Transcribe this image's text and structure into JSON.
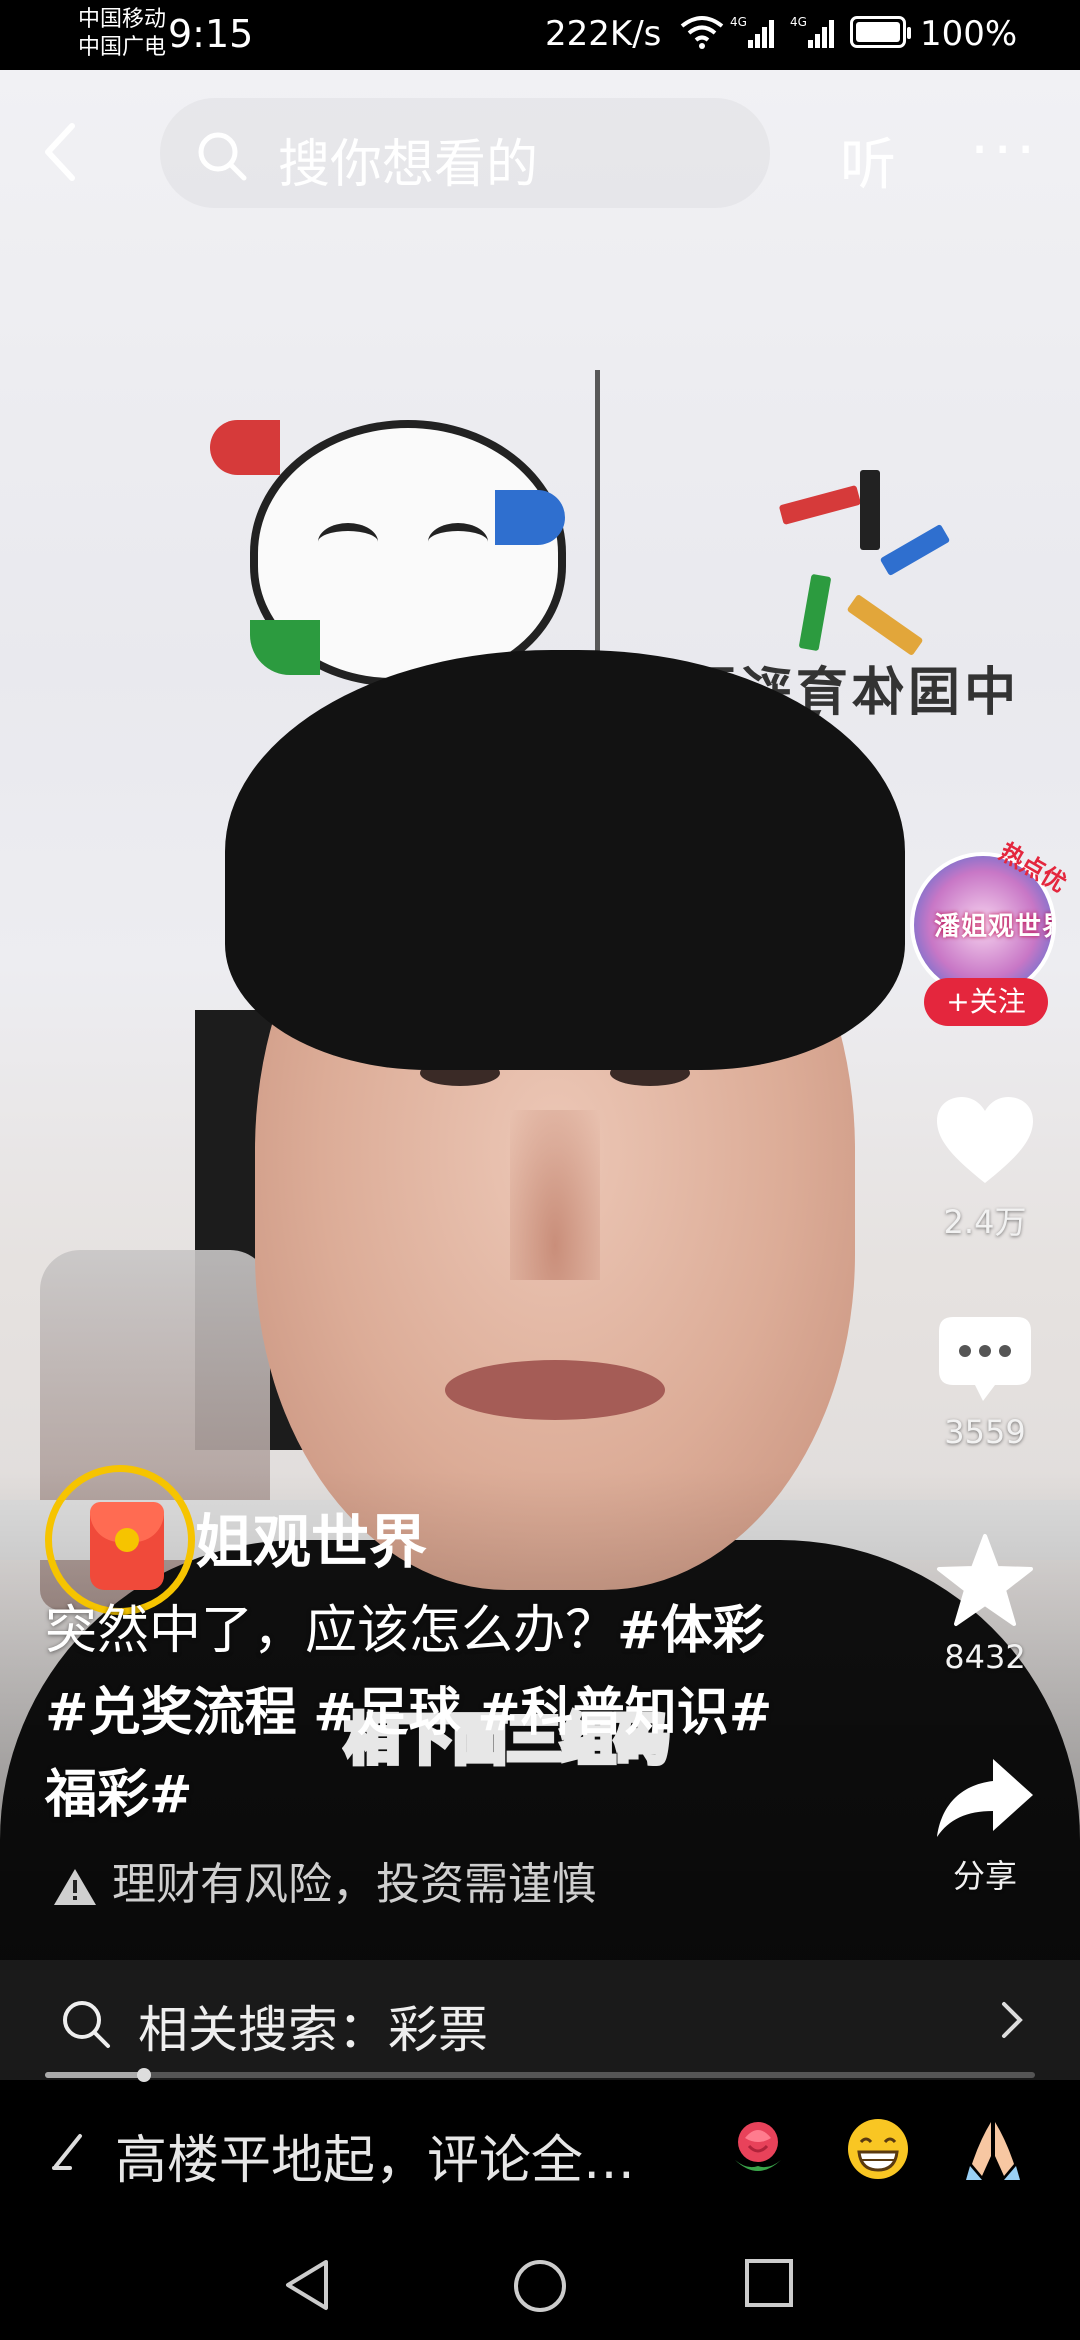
{
  "status_bar": {
    "carrier_1": "中国移动",
    "carrier_2": "中国广电",
    "time": "9:15",
    "net_speed": "222K/s",
    "battery_pct": "100%",
    "battery_level": 1.0
  },
  "top_nav": {
    "search_placeholder": "搜你想看的",
    "listen_label": "听",
    "more_label": "···"
  },
  "video": {
    "wall_sign_text": "中国体育彩票",
    "subtitle_overlay": "相下面三组码"
  },
  "creator": {
    "avatar_text": "潘姐观世界",
    "hot_badge": "热点优",
    "follow_label": "+关注"
  },
  "rail": {
    "likes": "2.4万",
    "comments": "3559",
    "favorites": "8432",
    "share_label": "分享"
  },
  "caption": {
    "author": "@潘姐观世界",
    "author_visible": "姐观世界",
    "text": "突然中了，应该怎么办？",
    "tags": [
      "#体彩",
      "#兑奖流程",
      "#足球",
      "#科普知识#",
      "福彩#"
    ]
  },
  "risk_notice": "理财有风险，投资需谨慎",
  "related_search": {
    "label": "相关搜索：彩票"
  },
  "progress": {
    "fraction": 0.1
  },
  "comment_bar": {
    "placeholder": "高楼平地起，评论全…",
    "emojis": [
      "rose-emoji",
      "grin-emoji",
      "pray-emoji"
    ]
  },
  "colors": {
    "follow_red": "#e4263d",
    "redpacket_ring": "#f6c400"
  }
}
